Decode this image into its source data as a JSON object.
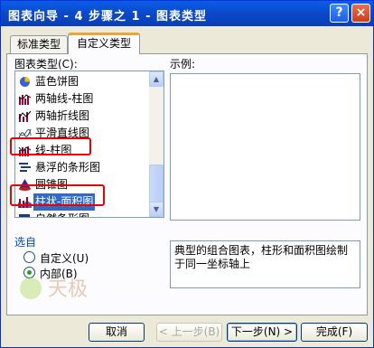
{
  "window": {
    "title": "图表向导 - 4 步骤之 1 - 图表类型",
    "help_label": "?",
    "close_label": "×"
  },
  "tabs": [
    {
      "label": "标准类型"
    },
    {
      "label": "自定义类型"
    }
  ],
  "chart_type_label": "图表类型(C):",
  "chart_types": [
    {
      "label": "蓝色饼图",
      "icon": "pie-chart-icon"
    },
    {
      "label": "两轴线-柱图",
      "icon": "line-column-icon"
    },
    {
      "label": "两轴折线图",
      "icon": "line-chart-icon"
    },
    {
      "label": "平滑直线图",
      "icon": "smooth-line-icon"
    },
    {
      "label": "线-柱图",
      "icon": "line-column-icon"
    },
    {
      "label": "悬浮的条形图",
      "icon": "floating-bar-icon"
    },
    {
      "label": "圆锥图",
      "icon": "cone-chart-icon"
    },
    {
      "label": "柱状-面积图",
      "icon": "column-area-icon",
      "selected": true
    },
    {
      "label": "自然条形图",
      "icon": "bar-chart-icon"
    }
  ],
  "preview_label": "示例:",
  "description": "典型的组合图表，柱形和面积图绘制于同一坐标轴上",
  "select_from": {
    "title": "选自",
    "options": [
      {
        "label": "自定义(U)",
        "checked": false
      },
      {
        "label": "内部(B)",
        "checked": true
      }
    ]
  },
  "buttons": {
    "cancel": "取消",
    "back": "< 上一步(B)",
    "next": "下一步(N) >",
    "finish": "完成(F)"
  },
  "watermark_text": "天极"
}
